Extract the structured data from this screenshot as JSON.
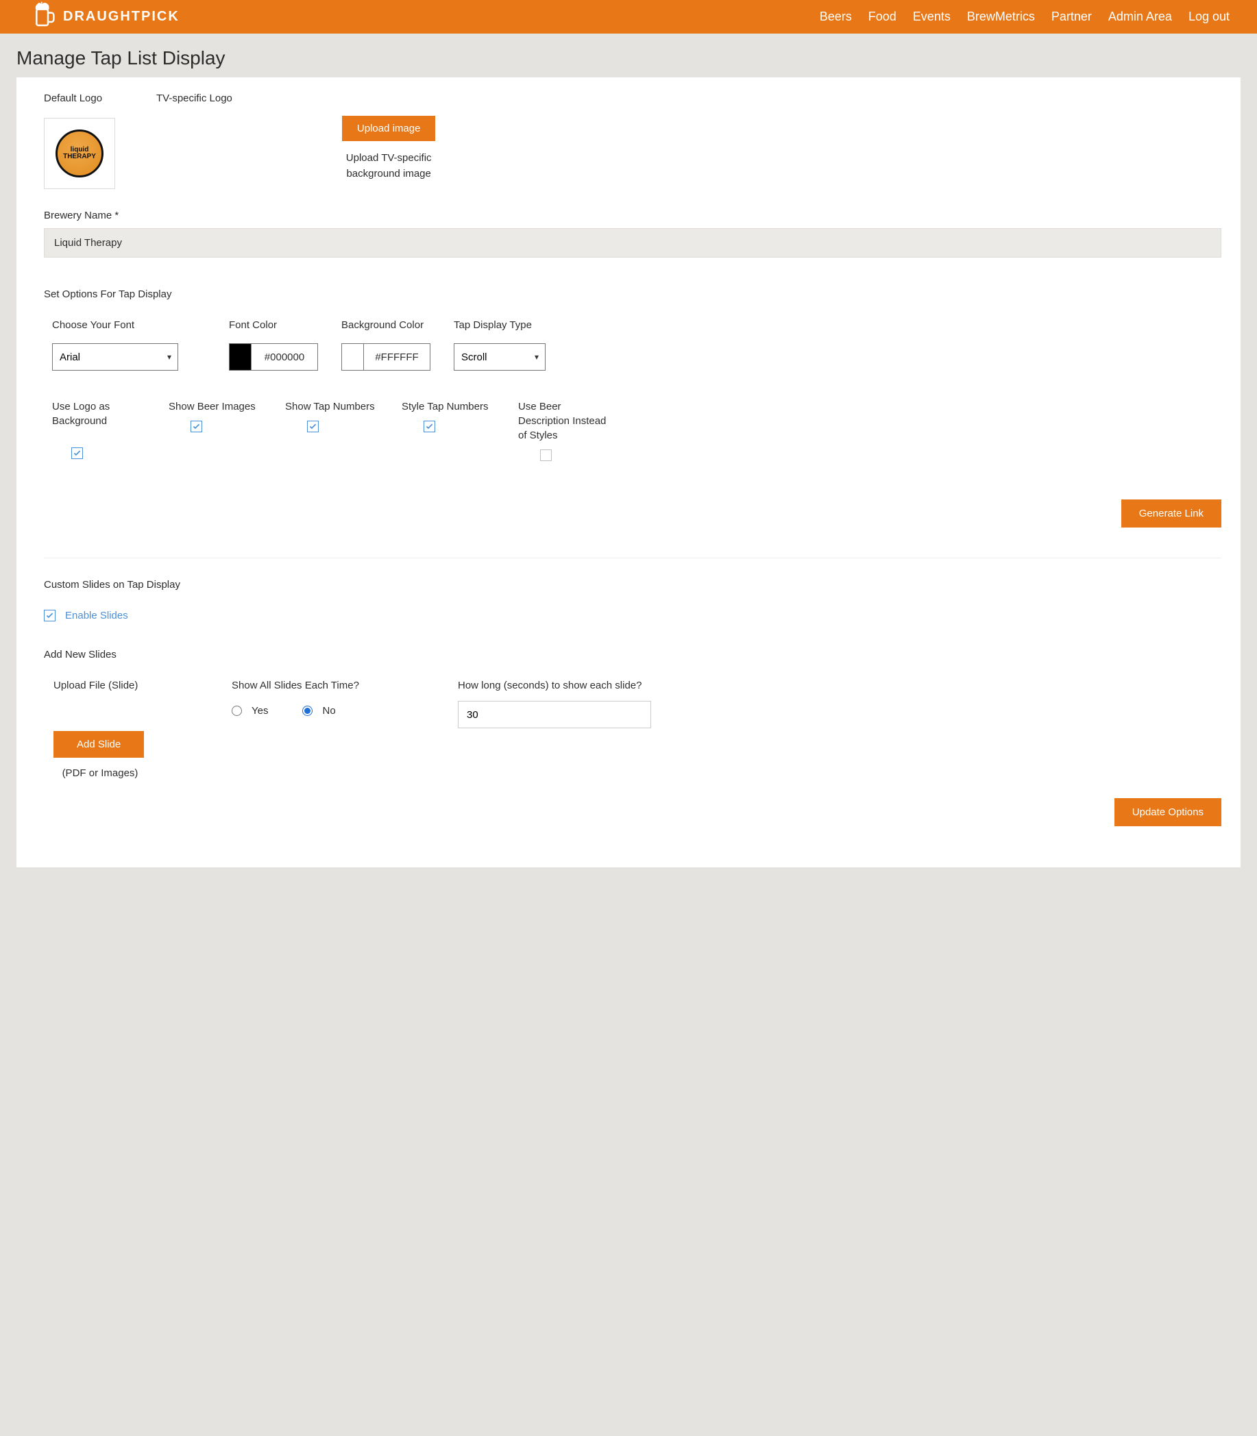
{
  "brand": {
    "name": "DRAUGHTPICK"
  },
  "nav": {
    "items": [
      "Beers",
      "Food",
      "Events",
      "BrewMetrics",
      "Partner",
      "Admin Area",
      "Log out"
    ]
  },
  "page": {
    "title": "Manage Tap List Display"
  },
  "logo": {
    "default_label": "Default Logo",
    "tv_label": "TV-specific Logo",
    "circle_text": "liquid THERAPY"
  },
  "upload": {
    "button": "Upload image",
    "desc_line1": "Upload TV-specific",
    "desc_line2": "background image"
  },
  "brewery": {
    "label": "Brewery Name *",
    "value": "Liquid Therapy"
  },
  "options": {
    "heading": "Set Options For Tap Display",
    "font_label": "Choose Your Font",
    "font_value": "Arial",
    "font_color_label": "Font Color",
    "font_color_value": "#000000",
    "bg_color_label": "Background Color",
    "bg_color_value": "#FFFFFF",
    "display_type_label": "Tap Display Type",
    "display_type_value": "Scroll",
    "checkboxes": [
      {
        "label": "Use Logo as Background",
        "checked": true,
        "offset_label": true
      },
      {
        "label": "Show Beer Images",
        "checked": true
      },
      {
        "label": "Show Tap Numbers",
        "checked": true
      },
      {
        "label": "Style Tap Numbers",
        "checked": true
      },
      {
        "label": "Use Beer Description Instead of Styles",
        "checked": false
      }
    ],
    "generate_link": "Generate Link"
  },
  "slides": {
    "heading": "Custom Slides on Tap Display",
    "enable_label": "Enable Slides",
    "enable_checked": true,
    "add_heading": "Add New Slides",
    "upload_label": "Upload File (Slide)",
    "show_all_label": "Show All Slides Each Time?",
    "yes": "Yes",
    "no": "No",
    "show_all_value": "No",
    "duration_label": "How long (seconds) to show each slide?",
    "duration_value": "30",
    "add_slide_btn": "Add Slide",
    "file_hint": "(PDF or Images)",
    "update_btn": "Update Options"
  },
  "colors": {
    "accent": "#e87817",
    "blue": "#4a90d9"
  }
}
